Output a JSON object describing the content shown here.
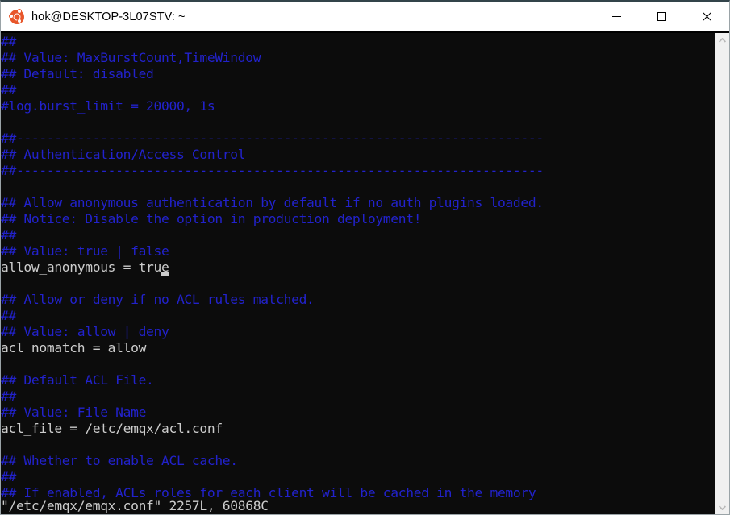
{
  "window": {
    "title": "hok@DESKTOP-3L07STV: ~",
    "app_icon": "ubuntu-logo-icon",
    "controls": {
      "minimize": "—",
      "maximize": "☐",
      "close": "✕"
    }
  },
  "colors": {
    "terminal_background": "#0c0c0c",
    "comment_blue": "#2222cc",
    "normal_text": "#cccccc",
    "titlebar_background": "#ffffff",
    "scrollbar_background": "#f0f0f0",
    "ubuntu_orange": "#e8562a"
  },
  "editor": {
    "file": "/etc/emqx/emqx.conf",
    "statusline": "\"/etc/emqx/emqx.conf\" 2257L, 60868C",
    "lines": [
      {
        "text": "##",
        "type": "comment"
      },
      {
        "text": "## Value: MaxBurstCount,TimeWindow",
        "type": "comment"
      },
      {
        "text": "## Default: disabled",
        "type": "comment"
      },
      {
        "text": "##",
        "type": "comment"
      },
      {
        "text": "#log.burst_limit = 20000, 1s",
        "type": "comment"
      },
      {
        "text": "",
        "type": "blank"
      },
      {
        "text": "##---------------------------------------------------------------------",
        "type": "comment"
      },
      {
        "text": "## Authentication/Access Control",
        "type": "comment"
      },
      {
        "text": "##---------------------------------------------------------------------",
        "type": "comment"
      },
      {
        "text": "",
        "type": "blank"
      },
      {
        "text": "## Allow anonymous authentication by default if no auth plugins loaded.",
        "type": "comment"
      },
      {
        "text": "## Notice: Disable the option in production deployment!",
        "type": "comment"
      },
      {
        "text": "##",
        "type": "comment"
      },
      {
        "text": "## Value: true | false",
        "type": "comment"
      },
      {
        "text": "allow_anonymous = true",
        "type": "setting",
        "cursor_col": 21
      },
      {
        "text": "",
        "type": "blank"
      },
      {
        "text": "## Allow or deny if no ACL rules matched.",
        "type": "comment"
      },
      {
        "text": "##",
        "type": "comment"
      },
      {
        "text": "## Value: allow | deny",
        "type": "comment"
      },
      {
        "text": "acl_nomatch = allow",
        "type": "setting"
      },
      {
        "text": "",
        "type": "blank"
      },
      {
        "text": "## Default ACL File.",
        "type": "comment"
      },
      {
        "text": "##",
        "type": "comment"
      },
      {
        "text": "## Value: File Name",
        "type": "comment"
      },
      {
        "text": "acl_file = /etc/emqx/acl.conf",
        "type": "setting"
      },
      {
        "text": "",
        "type": "blank"
      },
      {
        "text": "## Whether to enable ACL cache.",
        "type": "comment"
      },
      {
        "text": "##",
        "type": "comment"
      },
      {
        "text": "## If enabled, ACLs roles for each client will be cached in the memory",
        "type": "comment"
      }
    ]
  },
  "scrollbar": {
    "up_arrow": "chevron-up-icon",
    "down_arrow": "chevron-down-icon"
  }
}
